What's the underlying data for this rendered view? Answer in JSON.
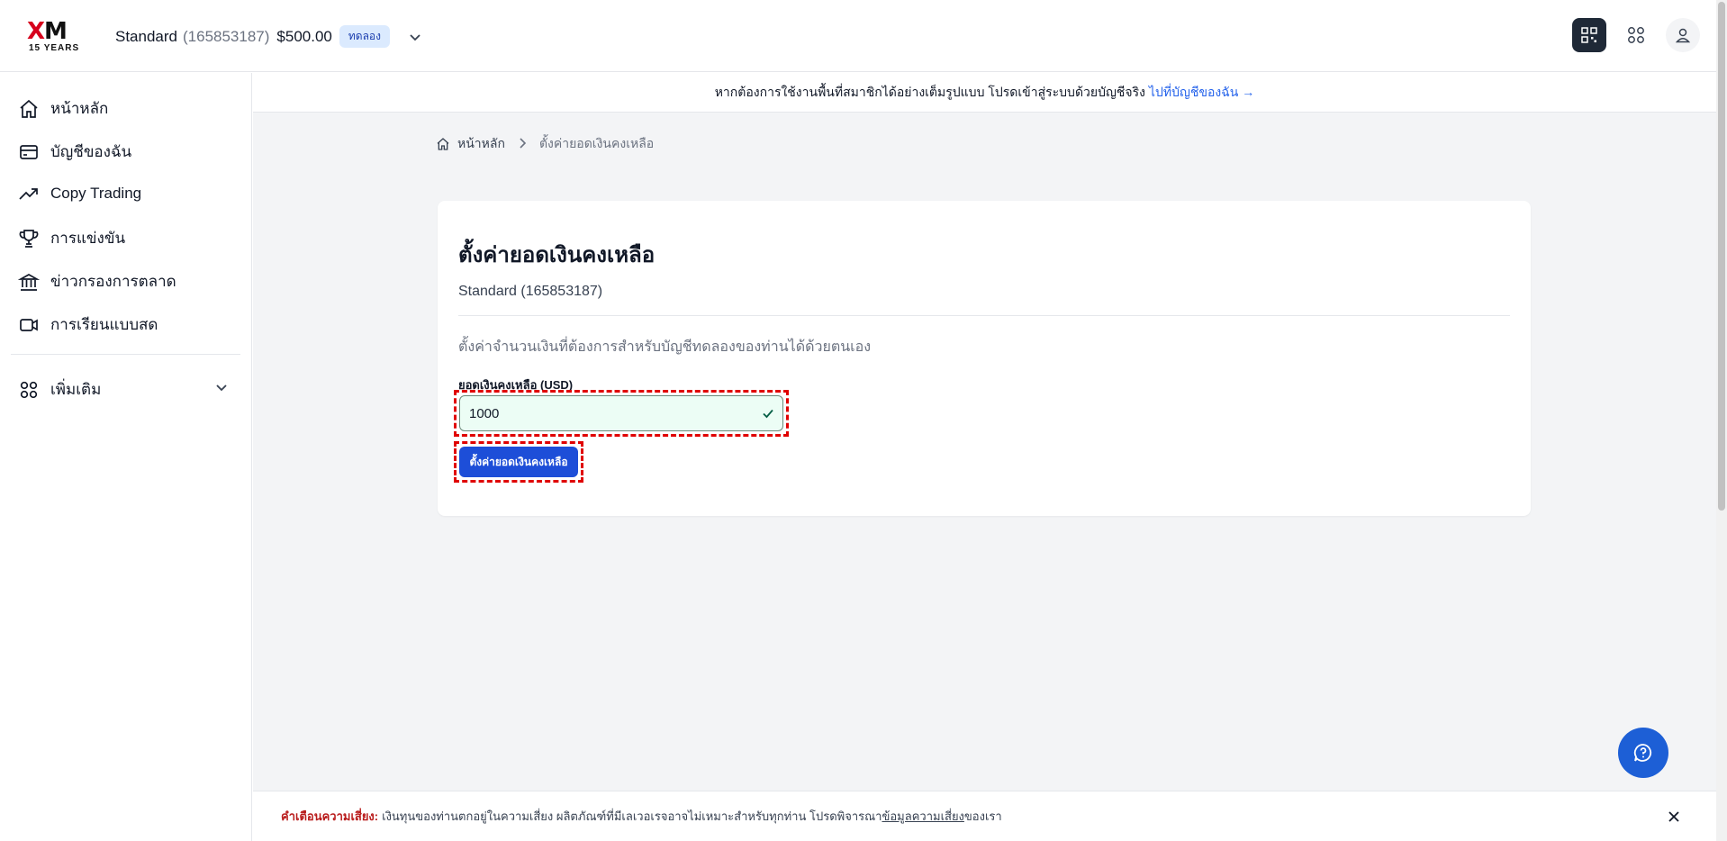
{
  "header": {
    "logo_text": "XM",
    "logo_sub": "15 YEARS",
    "account_name": "Standard",
    "account_number": "(165853187)",
    "balance": "$500.00",
    "badge": "ทดลอง"
  },
  "sidebar": {
    "items": [
      {
        "label": "หน้าหลัก",
        "icon": "home-icon"
      },
      {
        "label": "บัญชีของฉัน",
        "icon": "card-icon"
      },
      {
        "label": "Copy Trading",
        "icon": "trend-icon"
      },
      {
        "label": "การแข่งขัน",
        "icon": "trophy-icon"
      },
      {
        "label": "ข่าวกรองการตลาด",
        "icon": "bank-icon"
      },
      {
        "label": "การเรียนแบบสด",
        "icon": "video-icon"
      }
    ],
    "more_label": "เพิ่มเติม"
  },
  "banner": {
    "text": "หากต้องการใช้งานพื้นที่สมาชิกได้อย่างเต็มรูปแบบ โปรดเข้าสู่ระบบด้วยบัญชีจริง",
    "link": "ไปที่บัญชีของฉัน →"
  },
  "breadcrumb": {
    "home": "หน้าหลัก",
    "current": "ตั้งค่ายอดเงินคงเหลือ"
  },
  "card": {
    "title": "ตั้งค่ายอดเงินคงเหลือ",
    "account": "Standard (165853187)",
    "description": "ตั้งค่าจำนวนเงินที่ต้องการสำหรับบัญชีทดลองของท่านได้ด้วยตนเอง",
    "field_label": "ยอดเงินคงเหลือ (USD)",
    "field_value": "1000",
    "submit_label": "ตั้งค่ายอดเงินคงเหลือ"
  },
  "risk": {
    "label": "คำเตือนความเสี่ยง:",
    "text": "เงินทุนของท่านตกอยู่ในความเสี่ยง ผลิตภัณฑ์ที่มีเลเวอเรจอาจไม่เหมาะสำหรับทุกท่าน โปรดพิจารณา",
    "link": "ข้อมูลความเสี่ยง",
    "suffix": "ของเรา"
  },
  "colors": {
    "primary": "#1d4ed8",
    "warning": "#b91c1c"
  }
}
